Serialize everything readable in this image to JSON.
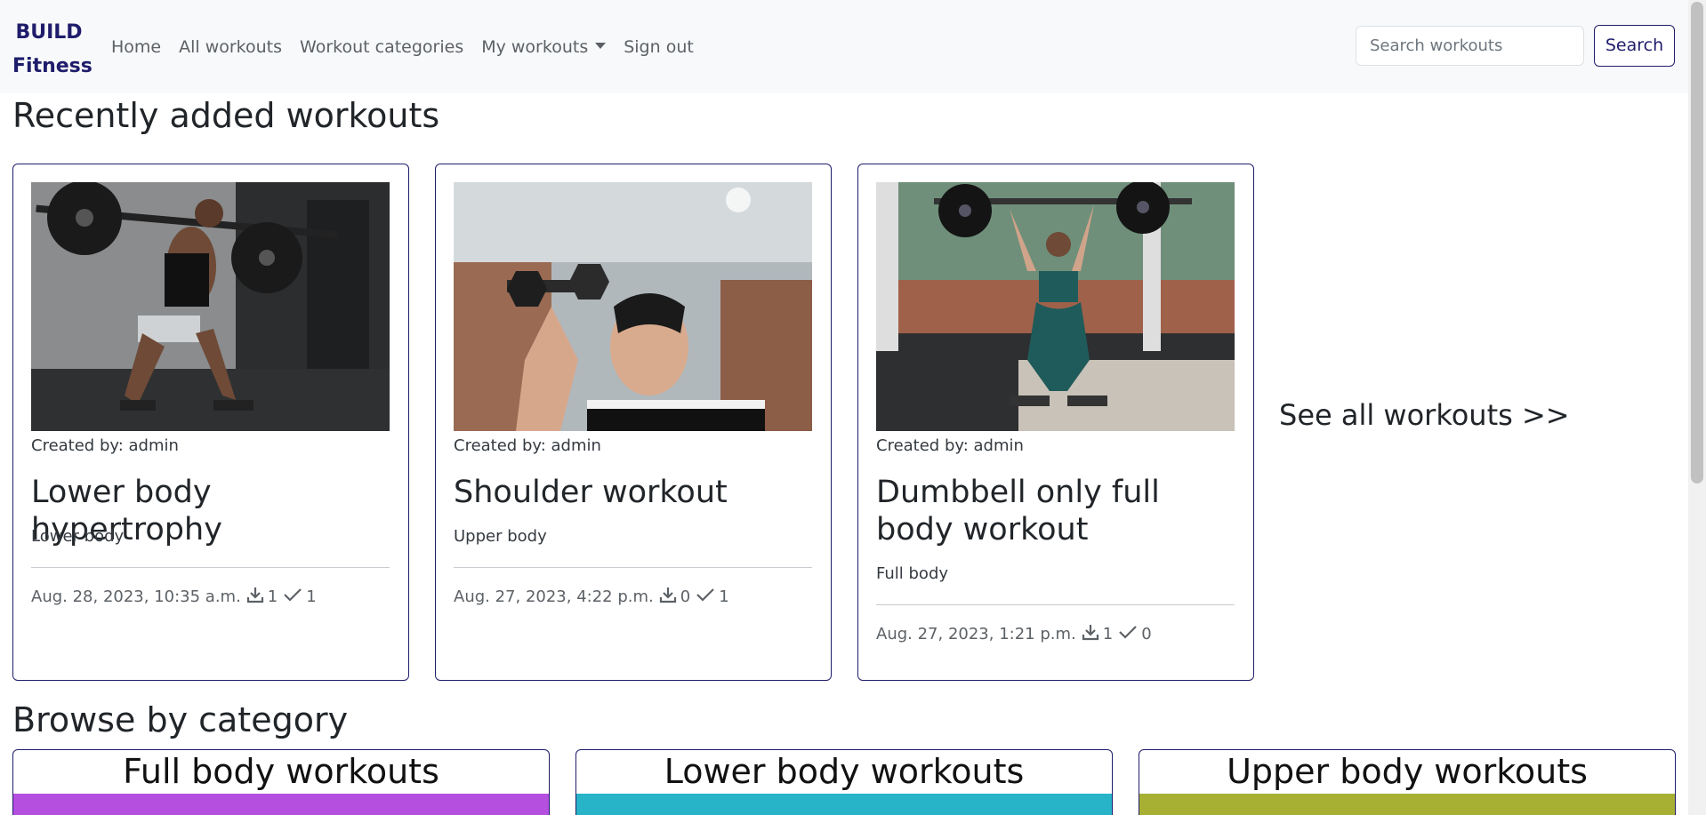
{
  "brand": {
    "line1": "BUILD",
    "line2": "Fitness"
  },
  "nav": {
    "home": "Home",
    "all_workouts": "All workouts",
    "workout_categories": "Workout categories",
    "my_workouts": "My workouts",
    "sign_out": "Sign out"
  },
  "search": {
    "placeholder": "Search workouts",
    "button": "Search"
  },
  "recent": {
    "title": "Recently added workouts",
    "cards": [
      {
        "created": "Created by: admin",
        "title": "Lower body hypertrophy",
        "category": "Lower body",
        "date": "Aug. 28, 2023, 10:35 a.m.",
        "downloads": "1",
        "completed": "1"
      },
      {
        "created": "Created by: admin",
        "title": "Shoulder workout",
        "category": "Upper body",
        "date": "Aug. 27, 2023, 4:22 p.m.",
        "downloads": "0",
        "completed": "1"
      },
      {
        "created": "Created by: admin",
        "title": "Dumbbell only full body workout",
        "category": "Full body",
        "date": "Aug. 27, 2023, 1:21 p.m.",
        "downloads": "1",
        "completed": "0"
      }
    ],
    "see_all": "See all workouts >>"
  },
  "browse": {
    "title": "Browse by category",
    "categories": [
      {
        "title": "Full body workouts",
        "color": "#b44fe0"
      },
      {
        "title": "Lower body workouts",
        "color": "#27b3c8"
      },
      {
        "title": "Upper body workouts",
        "color": "#a7b033"
      }
    ]
  },
  "colors": {
    "brand": "#1f1d6b",
    "nav_bg": "#f8f9fa",
    "border": "#1f1d6b"
  }
}
